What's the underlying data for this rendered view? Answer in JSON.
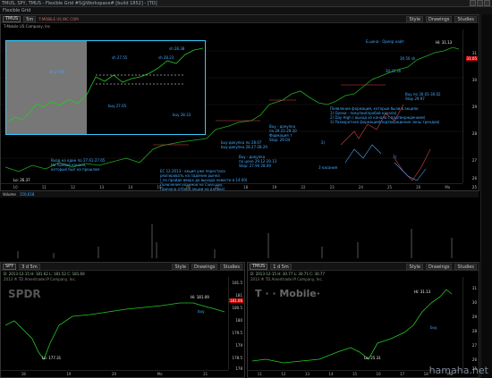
{
  "window": {
    "title": "TMUS, SPY, TMUS - Flexible Grid #5@Workspace# [build 1852] - [TD]"
  },
  "menubar": {
    "label": "Flexible Grid"
  },
  "main_panel": {
    "symbol": "TMUS",
    "toolbar": {
      "interval": "5m",
      "style": "Style",
      "drawings": "Drawings",
      "studies": "Studies"
    },
    "info": "T-MOBILE US INC COM",
    "company": "T-Mobile US Company, Inc",
    "y_ticks": [
      "31",
      "30",
      "29",
      "28",
      "27",
      "26",
      "25"
    ],
    "price_badge": "31.05",
    "x_ticks": [
      "10",
      "11",
      "12",
      "13",
      "14",
      "15",
      "16",
      "17",
      "18",
      "19",
      "22",
      "23",
      "24",
      "25",
      "26",
      "Mo"
    ],
    "annotations": {
      "low_start": "Lo: 26.37",
      "sh_2793": "sh 27.93",
      "sh_2755": "sh 27.55",
      "sh_2823": "sh 28.23",
      "sh_2838": "sh 28.38",
      "buy_2765": "buy 27.65",
      "buy_2833": "buy 28.33",
      "entry_note": "Вход на один по 27.61-27.65\nНа пробой канала,\nкоторый был на прошлом",
      "buy_levels": "buy-докупка по 28.07\nbuy-докупка 28.27-28.29",
      "buy_stop": "Buy - докупка\nпо цене 29.12-29.13\nStop: 27.94        28.09",
      "buy_2921": "Buy - докупка\nпо 29.21-29.20\nФормация ↑\nStop: 29.04",
      "note_1212": "ЕС 12.2013 - акция уже перестала\nреагировать на падение рынка\n( по пройде вверх до выхода новости в 14.00)\nПоявление объемов на Close day.\nПричина отбора акции на дневке)",
      "formation": "Формация: 3 касания",
      "t_3k": "3 касания",
      "wave_label": "3)",
      "right_list": "Появление формаций, которые были в акциях:\n1) Орехи - покупки(пробой канала)\n2) Day High ( выход из канала с подтверждением)\n3) Разворотная формация(подтверждение зоны трендов)",
      "note_2": "2)",
      "hi_3113": "Hi: 31.13",
      "open": "Б.цена - Openр найт",
      "sh_3050": "30.50 sh",
      "sh_3021": "30.21 sh",
      "buy_3001": "Buy по 30.01-30.02\nStop 29.97"
    }
  },
  "volume_bar": {
    "label": "Volume",
    "value": "150,618"
  },
  "spy_panel": {
    "symbol": "SPY",
    "toolbar": {
      "interval": "3 d 5m",
      "style": "Style",
      "drawings": "Drawings",
      "studies": "Studies"
    },
    "info": "SPDR S&P 500 ETF TR TR UNIT",
    "dt": "D: 2013-12-15 H: 181.62 L: 181.52 C: 181.69",
    "company": "2013 ® TD Ameritrade IP Company, Inc.",
    "y_ticks": [
      "181.5",
      "181",
      "180.5",
      "180",
      "179.5",
      "179",
      "178.5",
      "178"
    ],
    "price_badge": "181.06",
    "x_ticks": [
      "18",
      "19",
      "20",
      "Mo",
      "21"
    ],
    "hi": "Hi: 181.09",
    "lo": "Lo: 177.31",
    "buy": "buy",
    "logo": "SPDR"
  },
  "tmus_panel": {
    "symbol": "TMUS",
    "toolbar": {
      "interval": "1 d 5m",
      "style": "Style",
      "drawings": "Drawings",
      "studies": "Studies"
    },
    "info": "T-MOBILE US INC COM",
    "dt": "D: 2013-12-15 H: 30.77 L: 30.71 C: 30.77",
    "company": "2013 ® TD Ameritrade IP Company, Inc.",
    "y_ticks": [
      "31",
      "30",
      "29",
      "28",
      "27",
      "26",
      "25"
    ],
    "x_ticks": [
      "11",
      "12",
      "13",
      "14",
      "15",
      "16",
      "17",
      "18",
      "Mo"
    ],
    "hi": "Hi: 31.13",
    "lo": "Lo: 25.31",
    "buy": "buy",
    "logo": "T · · Mobile·"
  },
  "watermark": "hamaha.net"
}
